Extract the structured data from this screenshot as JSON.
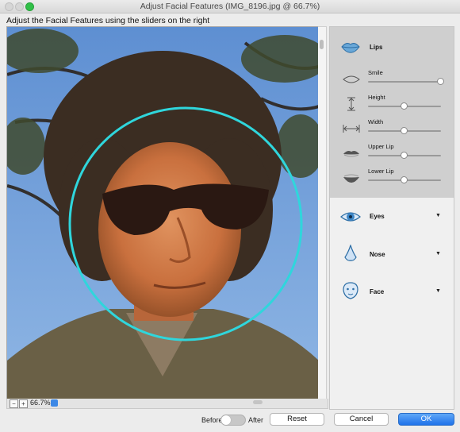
{
  "window": {
    "title": "Adjust Facial Features (IMG_8196.jpg @ 66.7%)",
    "instruction": "Adjust the Facial Features using the sliders on the right"
  },
  "viewer": {
    "zoom_label": "66.7%",
    "zoom_out_symbol": "−",
    "zoom_in_symbol": "+"
  },
  "panel": {
    "lips": {
      "label": "Lips",
      "icon": "lips-icon",
      "expanded": true,
      "sliders": [
        {
          "label": "Smile",
          "icon": "smile-icon",
          "value": 1.0
        },
        {
          "label": "Height",
          "icon": "height-icon",
          "value": 0.5
        },
        {
          "label": "Width",
          "icon": "width-icon",
          "value": 0.5
        },
        {
          "label": "Upper Lip",
          "icon": "upper-lip-icon",
          "value": 0.5
        },
        {
          "label": "Lower Lip",
          "icon": "lower-lip-icon",
          "value": 0.5
        }
      ]
    },
    "eyes": {
      "label": "Eyes",
      "icon": "eye-icon",
      "caret": "▼"
    },
    "nose": {
      "label": "Nose",
      "icon": "nose-icon",
      "caret": "▼"
    },
    "face": {
      "label": "Face",
      "icon": "face-icon",
      "caret": "▼"
    }
  },
  "footer": {
    "before_label": "Before",
    "after_label": "After",
    "reset_label": "Reset",
    "cancel_label": "Cancel",
    "ok_label": "OK"
  },
  "colors": {
    "face_circle": "#2fd6dc",
    "sky": "#6f9fd8",
    "ok_button": "#1f72ea",
    "panel_active": "#cfcfcf"
  }
}
